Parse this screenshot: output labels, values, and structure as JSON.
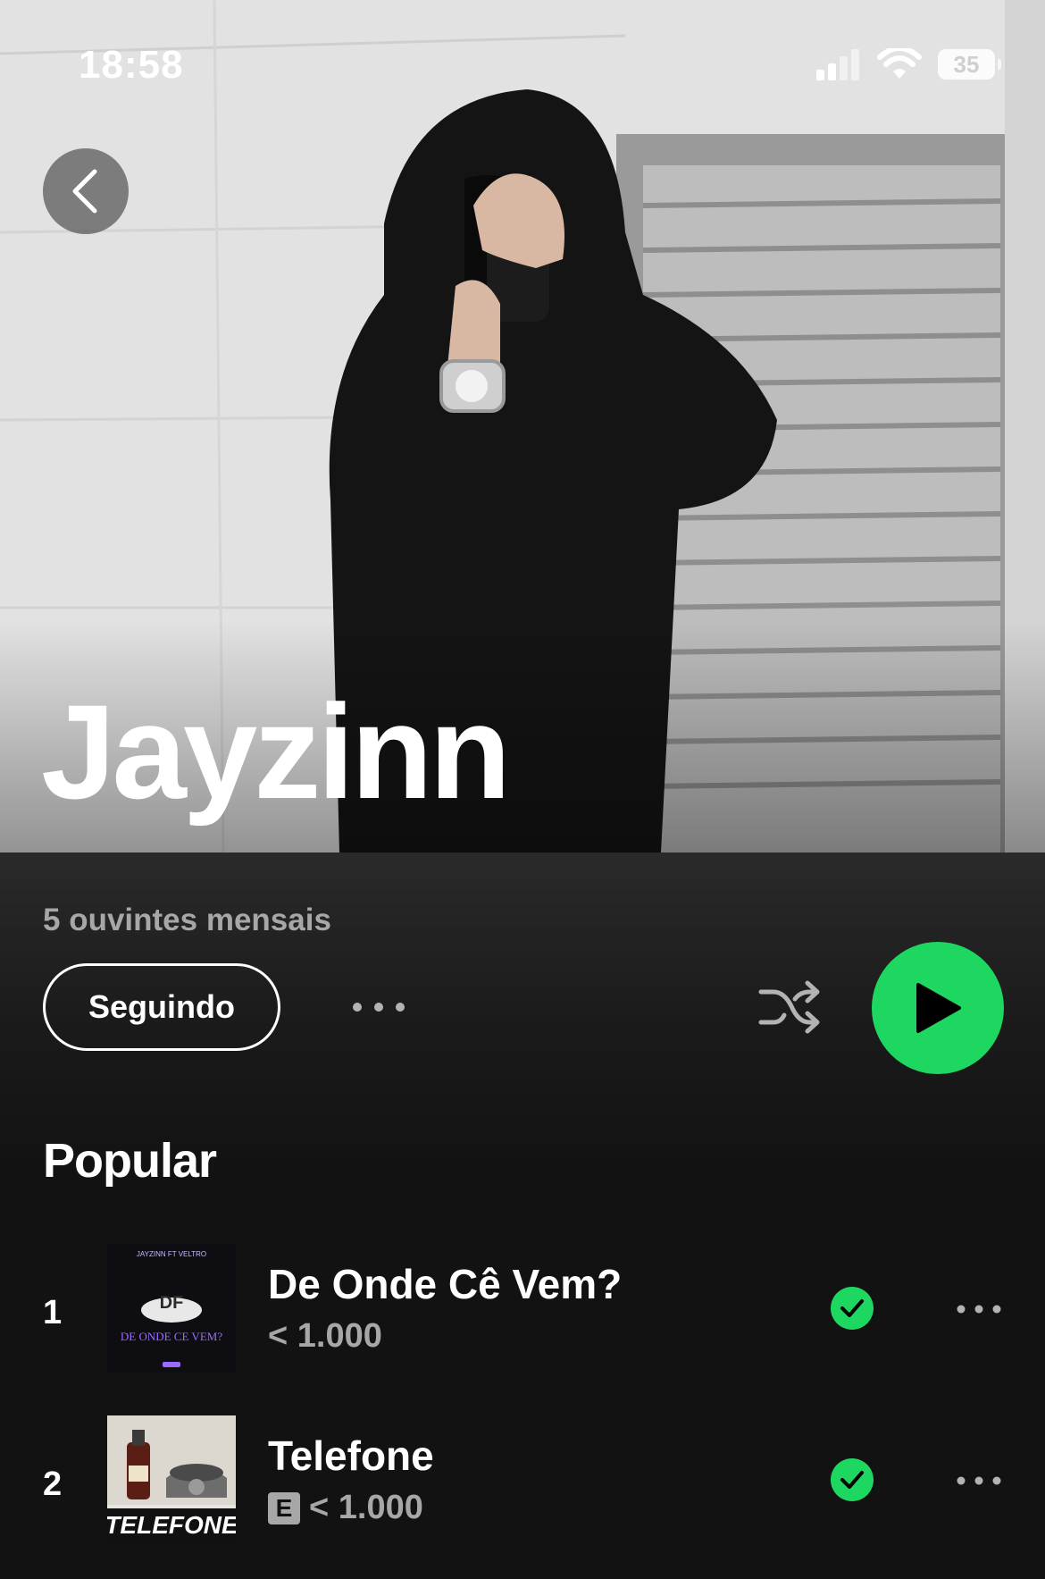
{
  "status_bar": {
    "time": "18:58",
    "battery": "35"
  },
  "artist": {
    "name": "Jayzinn",
    "monthly_listeners": "5 ouvintes mensais"
  },
  "actions": {
    "follow_label": "Seguindo"
  },
  "popular": {
    "title": "Popular",
    "tracks": [
      {
        "rank": "1",
        "title": "De Onde Cê Vem?",
        "plays": "< 1.000",
        "explicit": false,
        "art": {
          "top_text": "JAYZINN FT VELTRO",
          "logo": "DF",
          "bottom_text": "DE ONDE CE VEM?"
        }
      },
      {
        "rank": "2",
        "title": "Telefone",
        "plays": "< 1.000",
        "explicit": true,
        "explicit_label": "E",
        "art": {
          "label": "TELEFONE"
        }
      }
    ]
  },
  "colors": {
    "accent": "#1ed760",
    "background": "#121212",
    "secondary_text": "#a7a7a7"
  },
  "icons": [
    "back-chevron-icon",
    "signal-icon",
    "wifi-icon",
    "battery-icon",
    "more-icon",
    "shuffle-icon",
    "play-icon",
    "downloaded-check-icon"
  ]
}
